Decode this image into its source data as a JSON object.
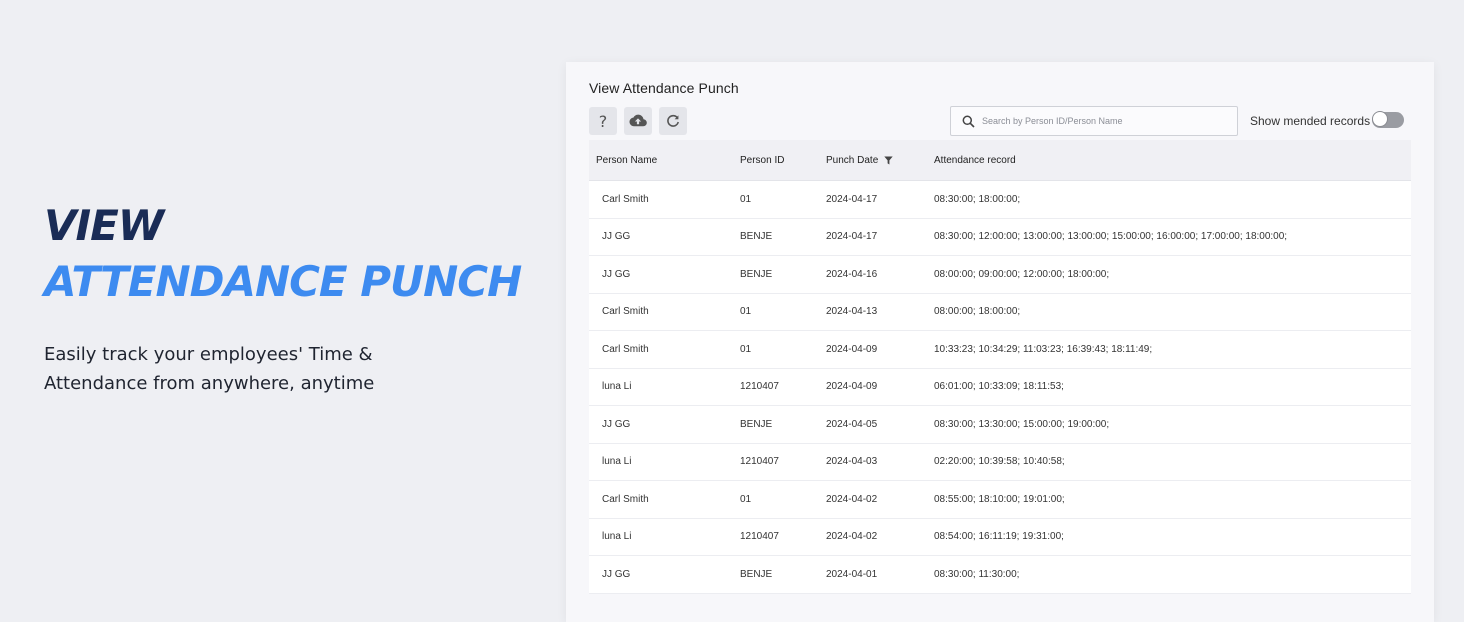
{
  "hero": {
    "line1": "VIEW",
    "line2": "ATTENDANCE PUNCH",
    "subtitle": "Easily track your employees' Time & Attendance from anywhere, anytime"
  },
  "app": {
    "title": "View Attendance Punch",
    "toolbar": {
      "help_icon": "question-mark-icon",
      "upload_icon": "cloud-upload-icon",
      "refresh_icon": "refresh-icon",
      "help_label": "?"
    },
    "search": {
      "placeholder": "Search by Person ID/Person Name",
      "value": ""
    },
    "show_mended": {
      "label": "Show mended records",
      "enabled": false
    },
    "table": {
      "columns": [
        "Person Name",
        "Person ID",
        "Punch Date",
        "Attendance record"
      ],
      "rows": [
        [
          "Carl Smith",
          "01",
          "2024-04-17",
          "08:30:00; 18:00:00;"
        ],
        [
          "JJ GG",
          "BENJE",
          "2024-04-17",
          "08:30:00; 12:00:00; 13:00:00; 13:00:00; 15:00:00; 16:00:00; 17:00:00; 18:00:00;"
        ],
        [
          "JJ GG",
          "BENJE",
          "2024-04-16",
          "08:00:00; 09:00:00; 12:00:00; 18:00:00;"
        ],
        [
          "Carl Smith",
          "01",
          "2024-04-13",
          "08:00:00; 18:00:00;"
        ],
        [
          "Carl Smith",
          "01",
          "2024-04-09",
          "10:33:23; 10:34:29; 11:03:23; 16:39:43; 18:11:49;"
        ],
        [
          "luna Li",
          "1210407",
          "2024-04-09",
          "06:01:00; 10:33:09; 18:11:53;"
        ],
        [
          "JJ GG",
          "BENJE",
          "2024-04-05",
          "08:30:00; 13:30:00; 15:00:00; 19:00:00;"
        ],
        [
          "luna Li",
          "1210407",
          "2024-04-03",
          "02:20:00; 10:39:58; 10:40:58;"
        ],
        [
          "Carl Smith",
          "01",
          "2024-04-02",
          "08:55:00; 18:10:00; 19:01:00;"
        ],
        [
          "luna Li",
          "1210407",
          "2024-04-02",
          "08:54:00; 16:11:19; 19:31:00;"
        ],
        [
          "JJ GG",
          "BENJE",
          "2024-04-01",
          "08:30:00; 11:30:00;"
        ]
      ]
    }
  },
  "colors": {
    "page_bg": "#eeeff3",
    "hero_dark": "#1a2c56",
    "hero_blue": "#3d8bf0",
    "panel_bg": "#f7f7fa"
  }
}
